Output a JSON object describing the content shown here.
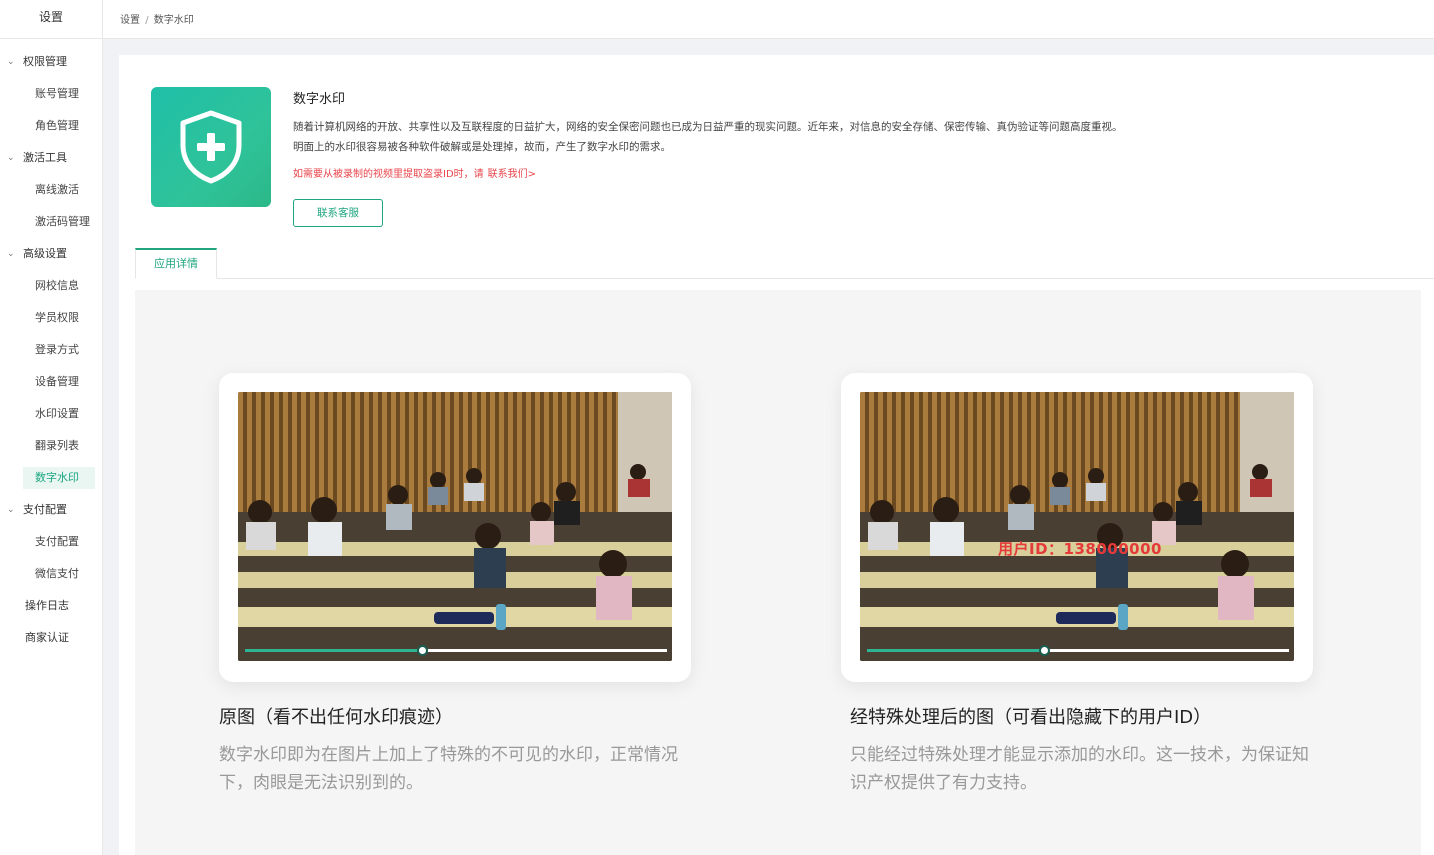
{
  "sidebar": {
    "title": "设置",
    "groups": [
      {
        "label": "权限管理",
        "items": [
          "账号管理",
          "角色管理"
        ]
      },
      {
        "label": "激活工具",
        "items": [
          "离线激活",
          "激活码管理"
        ]
      },
      {
        "label": "高级设置",
        "items": [
          "网校信息",
          "学员权限",
          "登录方式",
          "设备管理",
          "水印设置",
          "翻录列表",
          "数字水印"
        ]
      },
      {
        "label": "支付配置",
        "items": [
          "支付配置",
          "微信支付"
        ]
      }
    ],
    "singles": [
      "操作日志",
      "商家认证"
    ],
    "active": "数字水印"
  },
  "breadcrumb": {
    "root": "设置",
    "sep": "/",
    "current": "数字水印"
  },
  "app": {
    "title": "数字水印",
    "desc_line1": "随着计算机网络的开放、共享性以及互联程度的日益扩大，网络的安全保密问题也已成为日益严重的现实问题。近年来，对信息的安全存储、保密传输、真伪验证等问题高度重视。",
    "desc_line2": "明面上的水印很容易被各种软件破解或是处理掉，故而，产生了数字水印的需求。",
    "notice": "如需要从被录制的视频里提取盗录ID时，请",
    "notice_link": "联系我们>",
    "contact_button": "联系客服"
  },
  "tabs": [
    {
      "label": "应用详情",
      "active": true
    }
  ],
  "detail": {
    "left": {
      "title": "原图（看不出任何水印痕迹）",
      "desc": "数字水印即为在图片上加上了特殊的不可见的水印，正常情况下，肉眼是无法识别到的。",
      "progress": 0.42
    },
    "right": {
      "title": "经特殊处理后的图（可看出隐藏下的用户ID）",
      "desc": "只能经过特殊处理才能显示添加的水印。这一技术，为保证知识产权提供了有力支持。",
      "watermark": "用户ID：138000000",
      "progress": 0.42
    }
  },
  "colors": {
    "accent": "#1fa57f",
    "link_red": "#e8454b",
    "watermark_red": "#e53a3a"
  }
}
